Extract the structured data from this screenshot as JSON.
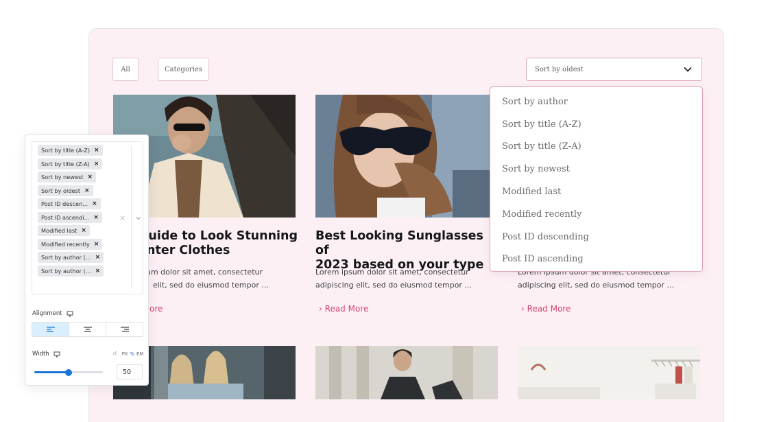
{
  "filters": {
    "all_label": "All",
    "categories_label": "Categories"
  },
  "sort": {
    "selected": "Sort by oldest",
    "options": [
      "Sort by author",
      "Sort by title (A-Z)",
      "Sort by title (Z-A)",
      "Sort by newest",
      "Modified last",
      "Modified recently",
      "Post ID descending",
      "Post ID ascending"
    ]
  },
  "posts": [
    {
      "title_line1": "Guide to Look Stunning",
      "title_line2": "nter Clothes",
      "excerpt_line1": "um dolor sit amet, consectetur",
      "excerpt_line2": "elit, sed do eiusmod tempor ...",
      "read_more": "ore"
    },
    {
      "title_line1": "Best Looking Sunglasses of",
      "title_line2": "2023 based on your type",
      "excerpt_line1": "Lorem ipsum dolor sit amet, consectetur",
      "excerpt_line2": "adipiscing elit, sed do eiusmod tempor ...",
      "read_more": "Read More"
    },
    {
      "excerpt_line1": "Lorem ipsum dolor sit amet, consectetur",
      "excerpt_line2": "adipiscing elit, sed do eiusmod tempor ...",
      "read_more": "Read More"
    }
  ],
  "control_panel": {
    "tags": [
      "Sort by title (A-Z)",
      "Sort by title (Z-A)",
      "Sort by newest",
      "Sort by oldest",
      "Post ID descen...",
      "Post ID ascendi...",
      "Modified last",
      "Modified recently",
      "Sort by author (...",
      "Sort by author (..."
    ],
    "alignment_label": "Alignment",
    "alignment_selected": "left",
    "width_label": "Width",
    "units": [
      "PX",
      "%",
      "EM"
    ],
    "active_unit": "%",
    "width_value": "50",
    "width_fraction": 0.5
  },
  "colors": {
    "accent": "#d4456f",
    "panel_bg": "#fdf0f5",
    "control_blue": "#1976d2"
  }
}
